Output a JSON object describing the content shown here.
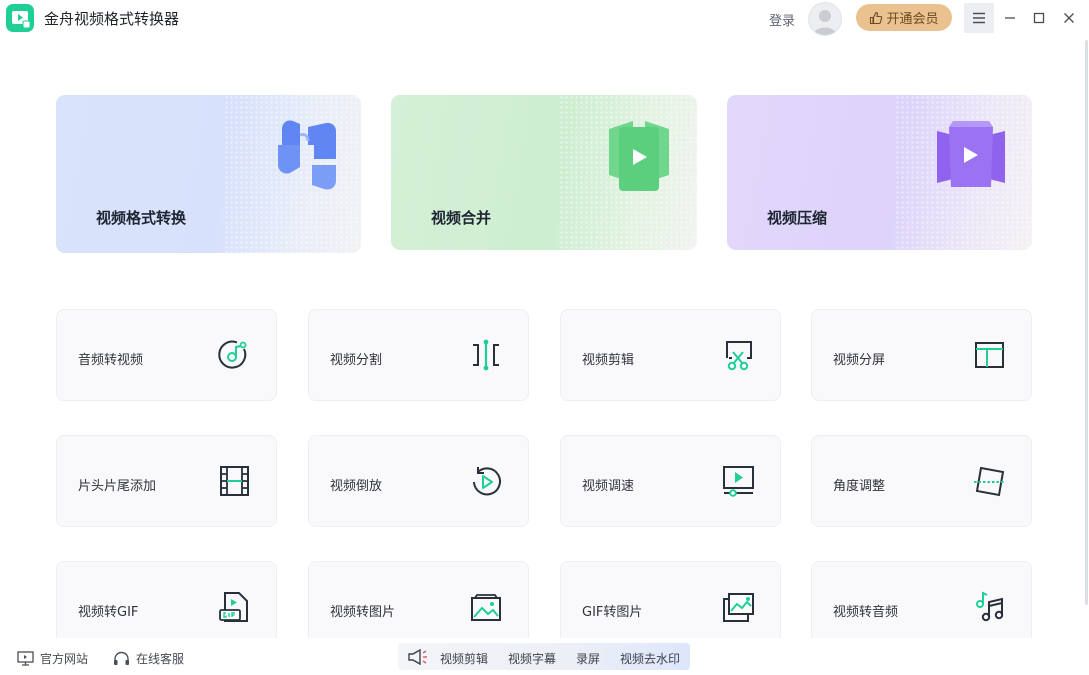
{
  "app": {
    "title": "金舟视频格式转换器",
    "accent": "#1fcf95"
  },
  "header": {
    "login_label": "登录",
    "vip_label": "开通会员",
    "vip_color": "#e9c28f",
    "icons": [
      "menu-icon",
      "minimize-icon",
      "maximize-icon",
      "close-icon"
    ]
  },
  "hero": [
    {
      "label": "视频格式转换",
      "icon": "format-convert-icon",
      "color": "#5f86f2"
    },
    {
      "label": "视频合并",
      "icon": "video-merge-icon",
      "color": "#57d37c"
    },
    {
      "label": "视频压缩",
      "icon": "video-compress-icon",
      "color": "#8f63ee"
    }
  ],
  "tools": [
    {
      "label": "音频转视频",
      "icon": "audio-to-video-icon"
    },
    {
      "label": "视频分割",
      "icon": "split-icon"
    },
    {
      "label": "视频剪辑",
      "icon": "scissors-icon"
    },
    {
      "label": "视频分屏",
      "icon": "split-screen-icon"
    },
    {
      "label": "片头片尾添加",
      "icon": "film-strip-icon"
    },
    {
      "label": "视频倒放",
      "icon": "reverse-play-icon"
    },
    {
      "label": "视频调速",
      "icon": "speed-icon"
    },
    {
      "label": "角度调整",
      "icon": "rotate-icon"
    },
    {
      "label": "视频转GIF",
      "icon": "gif-file-icon"
    },
    {
      "label": "视频转图片",
      "icon": "image-icon"
    },
    {
      "label": "GIF转图片",
      "icon": "gif-to-image-icon"
    },
    {
      "label": "视频转音频",
      "icon": "music-note-icon"
    }
  ],
  "tool_icon_color_dark": "#27303b",
  "tool_icon_color_accent": "#1fcf95",
  "footer": {
    "website_label": "官方网站",
    "support_label": "在线客服",
    "promo_items": [
      "视频剪辑",
      "视频字幕",
      "录屏",
      "视频去水印"
    ]
  }
}
